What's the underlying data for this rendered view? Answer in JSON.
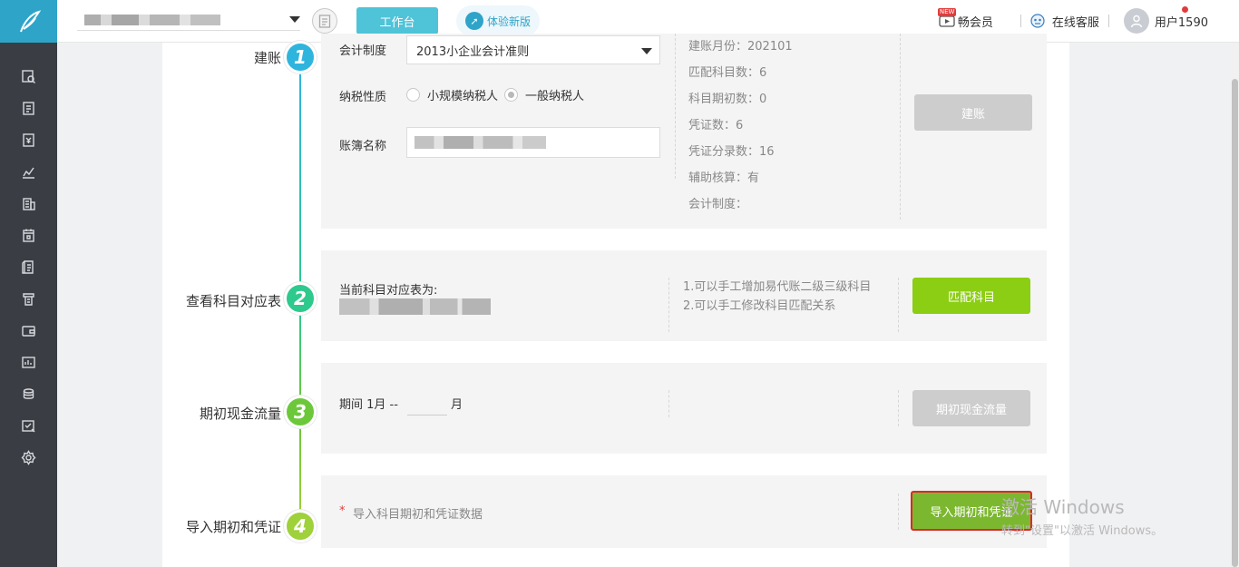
{
  "header": {
    "workbench_label": "工作台",
    "try_new_label": "体验新版",
    "member_new_badge": "NEW",
    "member_label": "畅会员",
    "service_label": "在线客服",
    "user_label": "用户1590"
  },
  "sidebar": {
    "icons": [
      "search-doc-icon",
      "document-icon",
      "invoice-icon",
      "chart-icon",
      "building-icon",
      "calendar-icon",
      "ledger-icon",
      "report-icon",
      "wallet-icon",
      "statement-icon",
      "coins-icon",
      "approval-icon",
      "settings-icon"
    ]
  },
  "steps": [
    {
      "number": "1",
      "label": "建账",
      "color": "#2fb5dd"
    },
    {
      "number": "2",
      "label": "查看科目对应表",
      "color": "#2ec98c"
    },
    {
      "number": "3",
      "label": "期初现金流量",
      "color": "#6cc83a"
    },
    {
      "number": "4",
      "label": "导入期初和凭证",
      "color": "#9ed13a"
    }
  ],
  "step1": {
    "accounting_system_label": "会计制度",
    "accounting_system_value": "2013小企业会计准则",
    "tax_label": "纳税性质",
    "tax_options": [
      "小规模纳税人",
      "一般纳税人"
    ],
    "tax_selected": "一般纳税人",
    "book_name_label": "账簿名称",
    "info": [
      "建账月份：202101",
      "匹配科目数：6",
      "科目期初数：0",
      "凭证数：6",
      "凭证分录数：16",
      "辅助核算：有",
      "会计制度："
    ],
    "button": "建账"
  },
  "step2": {
    "current_table_label": "当前科目对应表为:",
    "notes": [
      "1.可以手工增加易代账二级三级科目",
      "2.可以手工修改科目匹配关系"
    ],
    "button": "匹配科目"
  },
  "step3": {
    "period_prefix": "期间 1月 --",
    "period_suffix": "月",
    "button": "期初现金流量"
  },
  "step4": {
    "required_mark": "*",
    "hint": "导入科目期初和凭证数据",
    "button": "导入期初和凭证"
  },
  "watermark": {
    "title": "激活 Windows",
    "subtitle": "转到\"设置\"以激活 Windows。"
  },
  "colors": {
    "sidebar_bg": "#3a3d44",
    "logo_bg": "#2fa4c9",
    "accent": "#4fc3d8",
    "button_green": "#8cce13",
    "highlight_border": "#e0262a"
  }
}
